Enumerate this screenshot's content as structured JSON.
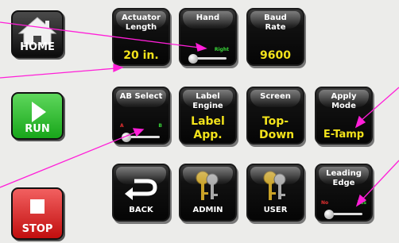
{
  "sidebar": {
    "home_label": "HOME",
    "run_label": "RUN",
    "stop_label": "STOP"
  },
  "tiles": {
    "actuator_length": {
      "title": "Actuator Length",
      "value": "20 in."
    },
    "hand": {
      "title": "Hand",
      "on_label": "Right"
    },
    "baud_rate": {
      "title": "Baud Rate",
      "value": "9600"
    },
    "ab_select": {
      "title": "AB Select",
      "off_label": "A",
      "on_label": "B"
    },
    "label_engine": {
      "title": "Label Engine",
      "value": "Label App."
    },
    "screen": {
      "title": "Screen",
      "value": "Top-Down"
    },
    "apply_mode": {
      "title": "Apply Mode",
      "value": "E-Tamp"
    },
    "back": {
      "label": "BACK"
    },
    "admin": {
      "label": "ADMIN"
    },
    "user": {
      "label": "USER"
    },
    "leading_edge": {
      "title": "Leading Edge",
      "off_label": "No",
      "on_label": "Yes"
    }
  },
  "colors": {
    "value_yellow": "#f2e21b",
    "toggle_on_green": "#39d639",
    "toggle_off_red": "#e53030",
    "callout_magenta": "#ff1fd8",
    "run_green": "#22b322",
    "stop_red": "#d61a1a"
  }
}
